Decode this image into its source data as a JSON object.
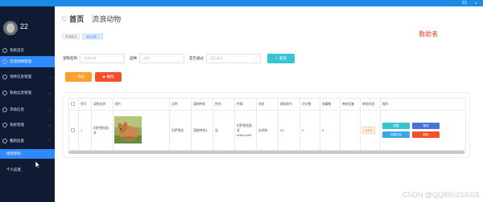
{
  "topbar": {
    "user": "22",
    "color": "#1a8ce8"
  },
  "sidebar": {
    "username": "22",
    "items": [
      {
        "label": "系统首页",
        "icon": "home-icon"
      },
      {
        "label": "流浪动物管理",
        "icon": "paw-icon",
        "active": true
      },
      {
        "label": "领养信息管理",
        "icon": "heart-icon"
      },
      {
        "label": "救助信息管理",
        "icon": "rescue-icon"
      },
      {
        "label": "求助信息",
        "icon": "help-icon"
      },
      {
        "label": "系统管理",
        "icon": "settings-icon"
      },
      {
        "label": "我的信息",
        "icon": "user-icon",
        "open": true
      }
    ],
    "subitems": [
      {
        "label": "修改密码",
        "active": true
      },
      {
        "label": "个人信息"
      }
    ]
  },
  "header": {
    "home": "首页",
    "title": "流浪动物",
    "tags": [
      "系统首页",
      "流浪动物 ×"
    ],
    "role": "救助者"
  },
  "search": {
    "name_label": "宠物名称",
    "name_placeholder": "宠物名称",
    "breed_label": "品种",
    "breed_placeholder": "品种",
    "passed_label": "是否通过",
    "passed_placeholder": "是否通过",
    "search_button": "查询"
  },
  "actions": {
    "add": "添加",
    "delete": "删除"
  },
  "table": {
    "columns": [
      "",
      "序号",
      "宠物名称",
      "图片",
      "品种",
      "宠物种类",
      "性别",
      "性情",
      "状态",
      "救助账号",
      "评论数",
      "收藏数",
      "审核回复",
      "审核状态",
      "操作"
    ],
    "rows": [
      {
        "index": "1",
        "name": "阿萨德发鼓弄",
        "breed": "阿萨德发",
        "species": "宠物种类4",
        "gender": "母",
        "temper": "阿萨德发鼓弄dfdfd,dfdf",
        "status": "未领养",
        "account": "22",
        "comments": "0",
        "favorites": "0",
        "review_reply": "",
        "review_status": "待审核"
      }
    ],
    "ops": {
      "view": "查看",
      "edit": "修改",
      "comment": "查看评论",
      "delete": "删除"
    }
  },
  "watermark": "CSDN @QQ860234001"
}
